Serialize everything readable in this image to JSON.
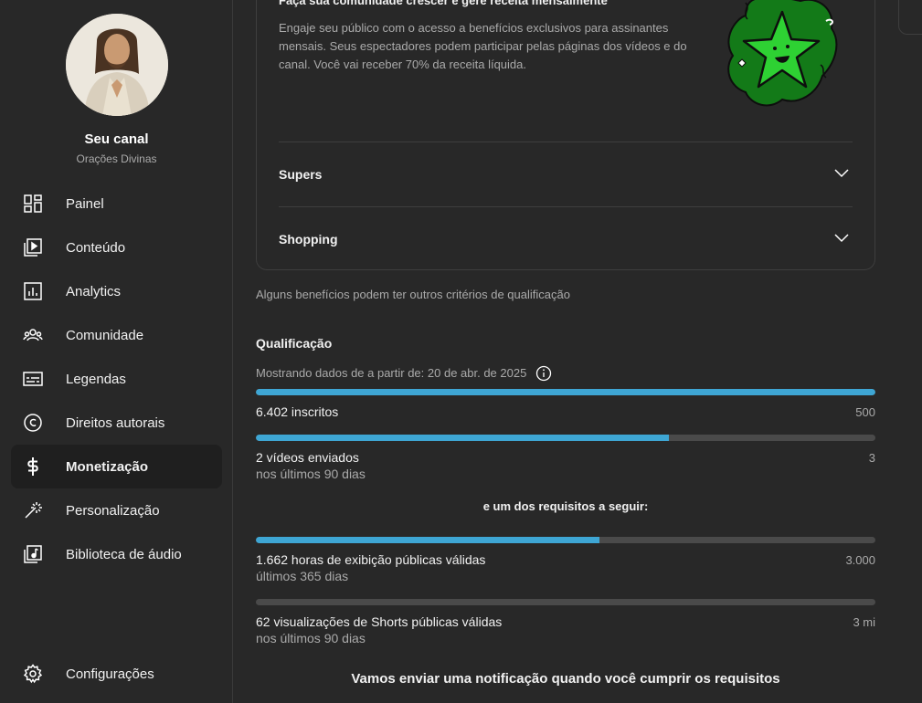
{
  "channel": {
    "title": "Seu canal",
    "name": "Orações Divinas"
  },
  "nav": {
    "items": [
      {
        "label": "Painel",
        "icon": "dashboard-icon"
      },
      {
        "label": "Conteúdo",
        "icon": "content-icon"
      },
      {
        "label": "Analytics",
        "icon": "analytics-icon"
      },
      {
        "label": "Comunidade",
        "icon": "community-icon"
      },
      {
        "label": "Legendas",
        "icon": "subtitles-icon"
      },
      {
        "label": "Direitos autorais",
        "icon": "copyright-icon"
      },
      {
        "label": "Monetização",
        "icon": "dollar-icon",
        "active": true
      },
      {
        "label": "Personalização",
        "icon": "magic-wand-icon"
      },
      {
        "label": "Biblioteca de áudio",
        "icon": "audio-library-icon"
      }
    ],
    "settings": "Configurações"
  },
  "membership_card": {
    "heading": "Faça sua comunidade crescer e gere receita mensalmente",
    "description": "Engaje seu público com o acesso a benefícios exclusivos para assinantes mensais. Seus espectadores podem participar pelas páginas dos vídeos e do canal. Você vai receber 70% da receita líquida.",
    "accordions": [
      "Supers",
      "Shopping"
    ]
  },
  "note": "Alguns benefícios podem ter outros critérios de qualificação",
  "qualification": {
    "title": "Qualificação",
    "since": "Mostrando dados de a partir de: 20 de abr. de 2025",
    "metrics": [
      {
        "label": "6.402 inscritos",
        "target": "500",
        "period": "",
        "progress": 1.0
      },
      {
        "label": "2 vídeos enviados",
        "target": "3",
        "period": "nos últimos 90 dias",
        "progress": 0.667
      },
      {
        "label": "1.662 horas de exibição públicas válidas",
        "target": "3.000",
        "period": "últimos 365 dias",
        "progress": 0.554
      },
      {
        "label": "62 visualizações de Shorts públicas válidas",
        "target": "3 mi",
        "period": "nos últimos 90 dias",
        "progress": 0.0
      }
    ],
    "requirement_text": "e um dos requisitos a seguir:",
    "notify_text": "Vamos enviar uma notificação quando você cumprir os requisitos"
  },
  "colors": {
    "accent": "#3ea6d4",
    "track": "#4a4a4a",
    "background": "#282828",
    "star_green": "#22c32a"
  }
}
